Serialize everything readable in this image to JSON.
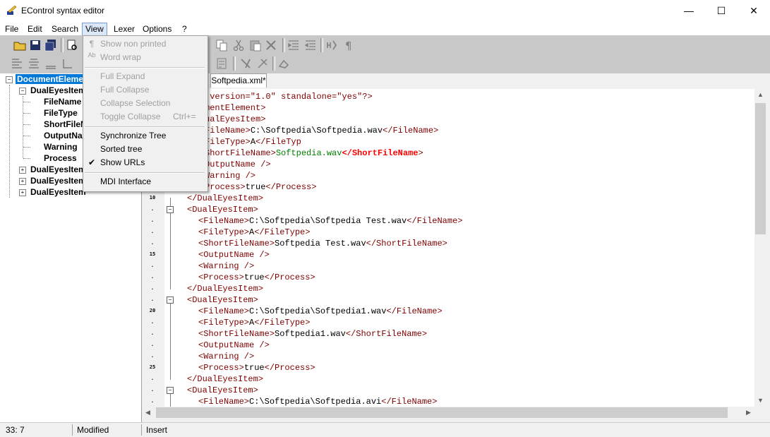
{
  "window": {
    "title": "EControl syntax editor",
    "min": "—",
    "max": "☐",
    "close": "✕"
  },
  "menubar": [
    "File",
    "Edit",
    "Search",
    "View",
    "Lexer",
    "Options",
    "?"
  ],
  "view_menu": {
    "show_non_printed": "Show non printed",
    "word_wrap": "Word wrap",
    "full_expand": "Full Expand",
    "full_collapse": "Full Collapse",
    "collapse_selection": "Collapse Selection",
    "toggle_collapse": "Toggle Collapse",
    "toggle_collapse_shortcut": "Ctrl+=",
    "synchronize_tree": "Synchronize Tree",
    "sorted_tree": "Sorted tree",
    "show_urls": "Show URLs",
    "mdi_interface": "MDI Interface"
  },
  "tree": {
    "root": "DocumentElement",
    "item1": "DualEyesItem",
    "children": [
      "FileName",
      "FileType",
      "ShortFileName",
      "OutputName",
      "Warning",
      "Process"
    ],
    "item2": "DualEyesItem",
    "item3": "DualEyesItem",
    "item4": "DualEyesItem"
  },
  "tab": {
    "label": "Softpedia.xml*"
  },
  "code": {
    "l1a": " version=\"1.0\" standalone=\"yes\"?>",
    "l2": "mentElement>",
    "l3": "ualEyesItem>",
    "l4a": "FileName>",
    "l4b": "C:\\Softpedia\\Softpedia.wav",
    "l4c": "</FileName>",
    "l5a": "FileType>",
    "l5b": "A",
    "l5c": "</FileTyp",
    "l6a": "ShortFileName>",
    "l6b": "Softpedia.wav",
    "l6c": "</ShortFileName",
    "l6d": ">",
    "l7": "OutputName />",
    "l8": "Warning />",
    "l9a": "Process>",
    "l9b": "true",
    "l9c": "</Process>",
    "close_item": "</DualEyesItem>",
    "open_item": "<DualEyesItem>",
    "fn_open": "<FileName>",
    "fn_close": "</FileName>",
    "ft_open": "<FileType>",
    "ft_close": "</FileType>",
    "sfn_open": "<ShortFileName>",
    "sfn_close": "</ShortFileName>",
    "out": "<OutputName />",
    "warn": "<Warning />",
    "proc_open": "<Process>",
    "proc_close": "</Process>",
    "val_true": "true",
    "val_a": "A",
    "path2": "C:\\Softpedia\\Softpedia Test.wav",
    "short2": "Softpedia Test.wav",
    "path3": "C:\\Softpedia\\Softpedia1.wav",
    "short3": "Softpedia1.wav",
    "path4": "C:\\Softpedia\\Softpedia.avi"
  },
  "line_numbers": {
    "n10": "10",
    "n15": "15",
    "n20": "20",
    "n25": "25",
    "dot": "."
  },
  "status": {
    "position": "33: 7",
    "state": "Modified",
    "mode": "Insert"
  }
}
